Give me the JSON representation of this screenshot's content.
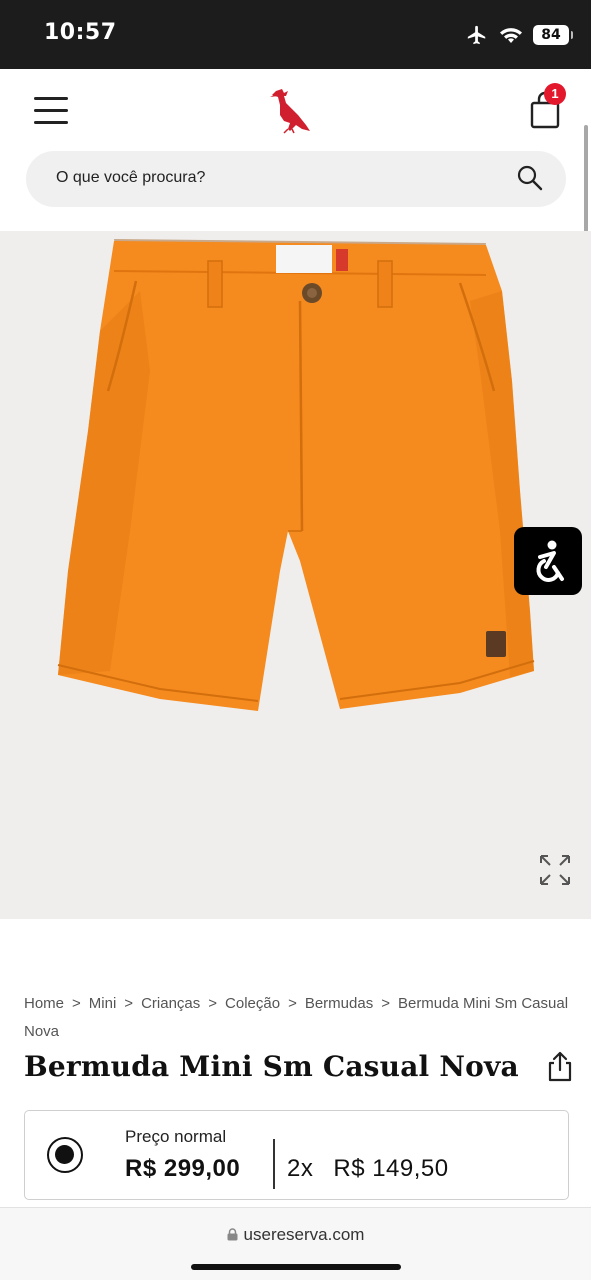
{
  "status_bar": {
    "time": "10:57",
    "battery": "84",
    "icons": [
      "airplane-icon",
      "wifi-icon",
      "battery-icon"
    ]
  },
  "header": {
    "cart_count": "1",
    "search_placeholder": "O que você procura?",
    "brand_color": "#d01f2e"
  },
  "breadcrumb": [
    "Home",
    "Mini",
    "Crianças",
    "Coleção",
    "Bermudas",
    "Bermuda Mini Sm Casual Nova"
  ],
  "breadcrumb_separator": ">",
  "product": {
    "title": "Bermuda Mini Sm Casual Nova",
    "image_color": "#f58a1f",
    "price_label": "Preço normal",
    "price": "R$ 299,00",
    "installments_count": "2x",
    "installment_value": "R$ 149,50"
  },
  "browser": {
    "url": "usereserva.com"
  }
}
